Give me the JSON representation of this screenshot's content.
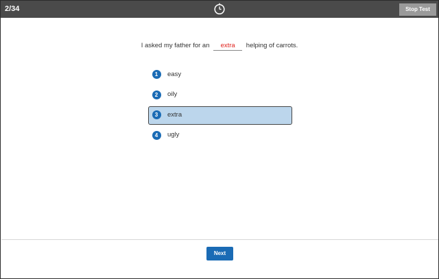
{
  "header": {
    "progress": "2/34",
    "stop_label": "Stop Test",
    "timer_icon": "clock-icon"
  },
  "question": {
    "before": "I asked my father for an",
    "answer": "extra",
    "after": "helping of carrots."
  },
  "options": [
    {
      "number": "1",
      "label": "easy",
      "selected": false
    },
    {
      "number": "2",
      "label": "oily",
      "selected": false
    },
    {
      "number": "3",
      "label": "extra",
      "selected": true
    },
    {
      "number": "4",
      "label": "ugly",
      "selected": false
    }
  ],
  "footer": {
    "next_label": "Next"
  },
  "colors": {
    "topbar": "#4a4a4a",
    "accent": "#1a6bb5",
    "selected_bg": "#bcd6ec",
    "answer_text": "#e0231e"
  }
}
